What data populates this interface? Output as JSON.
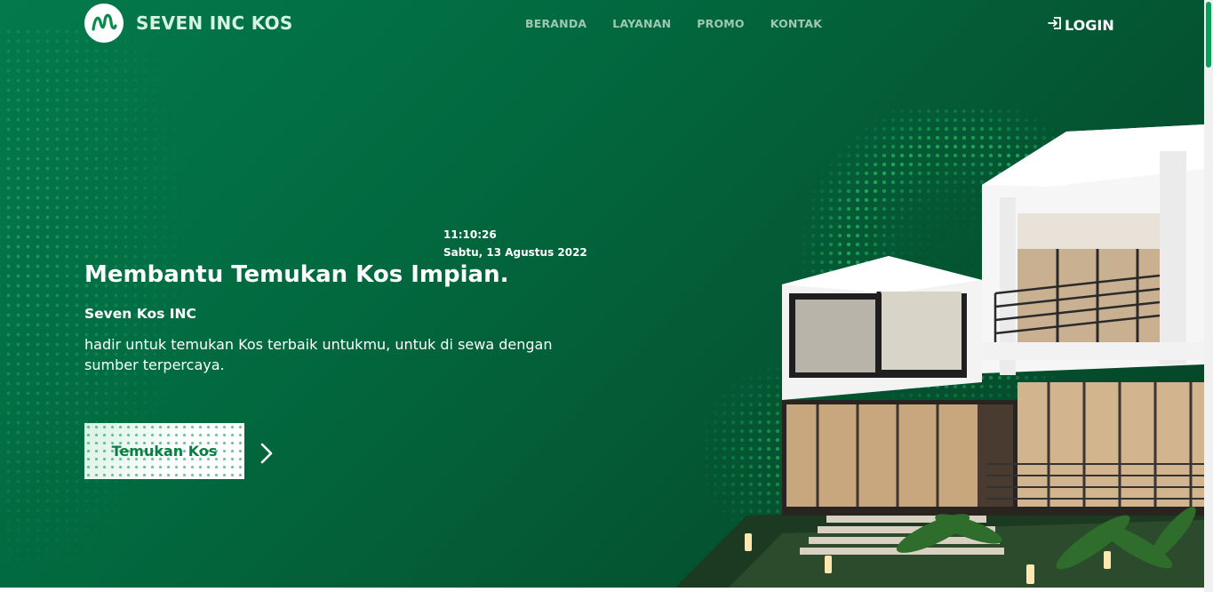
{
  "header": {
    "brand": "SEVEN INC KOS",
    "logo_icon": "m-wave-logo-icon",
    "nav": [
      {
        "label": "BERANDA"
      },
      {
        "label": "LAYANAN"
      },
      {
        "label": "PROMO"
      },
      {
        "label": "KONTAK"
      }
    ],
    "login": {
      "label": "LOGIN",
      "icon": "login-icon"
    }
  },
  "clock": {
    "time": "11:10:26",
    "date": "Sabtu, 13 Agustus 2022"
  },
  "hero": {
    "headline": "Membantu Temukan Kos Impian.",
    "subheadline": "Seven Kos INC",
    "description": "hadir untuk temukan Kos terbaik untukmu, untuk di sewa dengan sumber terpercaya.",
    "cta_label": "Temukan Kos",
    "next_icon": "chevron-right-icon",
    "image": "modern-house-illustration"
  },
  "colors": {
    "bg_start": "#037a4c",
    "bg_end": "#063f24",
    "accent": "#08a05a",
    "brand_text": "#d7f2e1",
    "nav_text": "#9fc8b0"
  }
}
